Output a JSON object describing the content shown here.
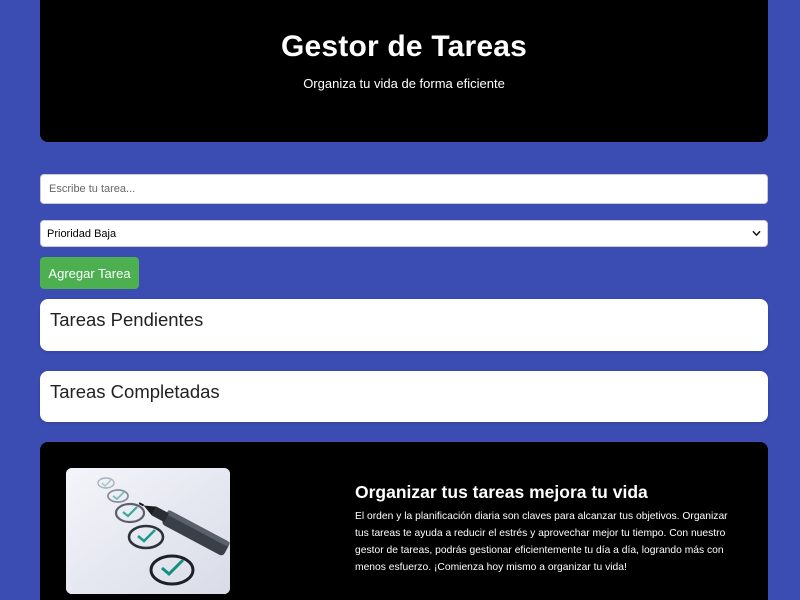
{
  "header": {
    "title": "Gestor de Tareas",
    "subtitle": "Organiza tu vida de forma eficiente"
  },
  "form": {
    "task_placeholder": "Escribe tu tarea...",
    "priority_selected": "Prioridad Baja",
    "add_button_label": "Agregar Tarea"
  },
  "sections": {
    "pending_title": "Tareas Pendientes",
    "completed_title": "Tareas Completadas"
  },
  "promo": {
    "title": "Organizar tus tareas mejora tu vida",
    "body": "El orden y la planificación diaria son claves para alcanzar tus objetivos. Organizar tus tareas te ayuda a reducir el estrés y aprovechar mejor tu tiempo. Con nuestro gestor de tareas, podrás gestionar eficientemente tu día a día, logrando más con menos esfuerzo. ¡Comienza hoy mismo a organizar tu vida!",
    "image_icon": "checklist-image"
  },
  "colors": {
    "page_background": "#3b4db3",
    "panel_background": "#000000",
    "button_green": "#4caf50"
  }
}
